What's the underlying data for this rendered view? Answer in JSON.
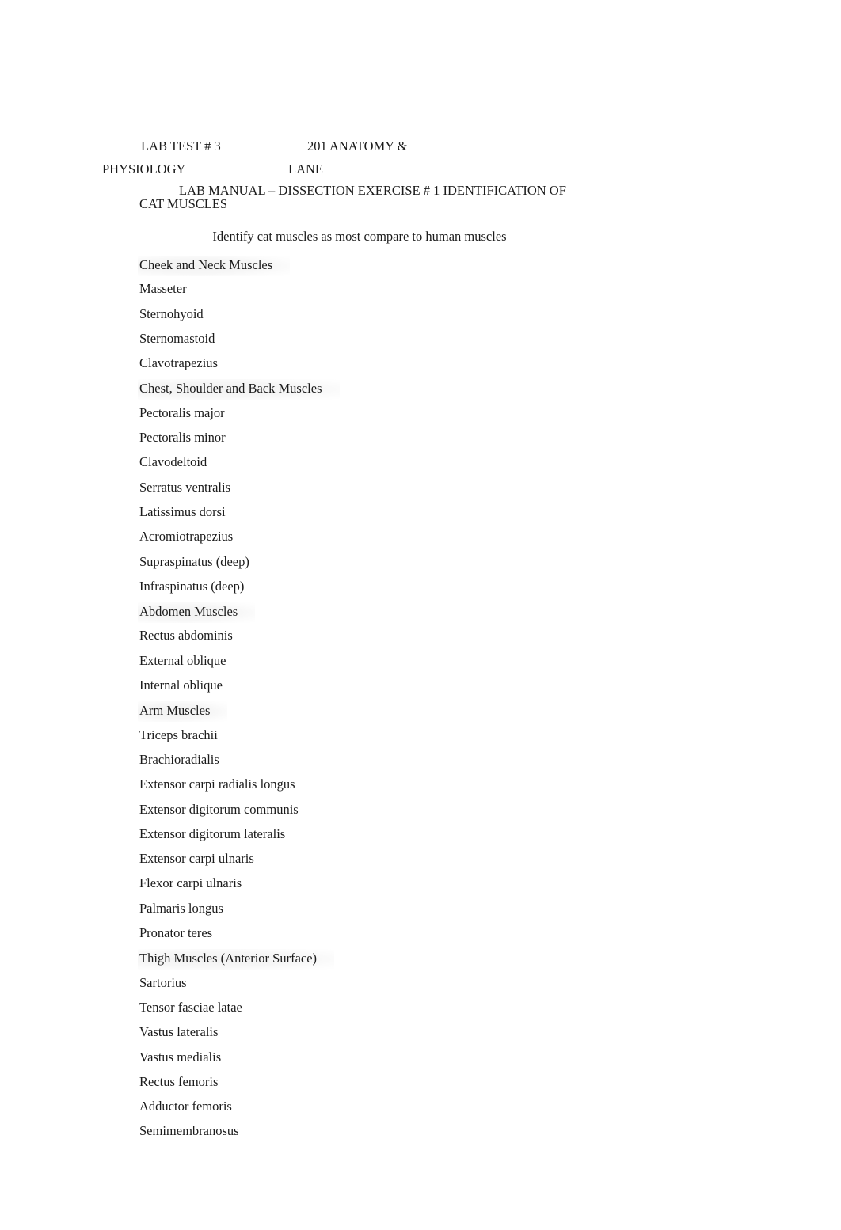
{
  "header": {
    "line1_left": "LAB TEST # 3",
    "line1_right": "201 ANATOMY &",
    "line2_left": "PHYSIOLOGY",
    "line2_right": "LANE"
  },
  "title": "LAB MANUAL – DISSECTION EXERCISE # 1 IDENTIFICATION OF CAT MUSCLES",
  "subtitle": "Identify cat muscles as most compare to human muscles",
  "list": [
    {
      "text": "Cheek and Neck Muscles",
      "type": "section"
    },
    {
      "text": "Masseter",
      "type": "item"
    },
    {
      "text": "Sternohyoid",
      "type": "item"
    },
    {
      "text": "Sternomastoid",
      "type": "item"
    },
    {
      "text": "Clavotrapezius",
      "type": "item"
    },
    {
      "text": "Chest, Shoulder and Back Muscles",
      "type": "section"
    },
    {
      "text": "Pectoralis major",
      "type": "item"
    },
    {
      "text": "Pectoralis minor",
      "type": "item"
    },
    {
      "text": "Clavodeltoid",
      "type": "item"
    },
    {
      "text": "Serratus ventralis",
      "type": "item"
    },
    {
      "text": "Latissimus dorsi",
      "type": "item"
    },
    {
      "text": "Acromiotrapezius",
      "type": "item"
    },
    {
      "text": "Supraspinatus (deep)",
      "type": "item"
    },
    {
      "text": "Infraspinatus (deep)",
      "type": "item"
    },
    {
      "text": "Abdomen Muscles",
      "type": "section"
    },
    {
      "text": "Rectus abdominis",
      "type": "item"
    },
    {
      "text": "External oblique",
      "type": "item"
    },
    {
      "text": "Internal oblique",
      "type": "item"
    },
    {
      "text": "Arm Muscles",
      "type": "section"
    },
    {
      "text": "Triceps brachii",
      "type": "item"
    },
    {
      "text": "Brachioradialis",
      "type": "item"
    },
    {
      "text": "Extensor carpi radialis longus",
      "type": "item"
    },
    {
      "text": "Extensor digitorum communis",
      "type": "item"
    },
    {
      "text": "Extensor digitorum lateralis",
      "type": "item"
    },
    {
      "text": "Extensor carpi ulnaris",
      "type": "item"
    },
    {
      "text": "Flexor carpi ulnaris",
      "type": "item"
    },
    {
      "text": "Palmaris longus",
      "type": "item"
    },
    {
      "text": "Pronator teres",
      "type": "item"
    },
    {
      "text": "Thigh Muscles (Anterior Surface)",
      "type": "section"
    },
    {
      "text": "Sartorius",
      "type": "item"
    },
    {
      "text": "Tensor fasciae latae",
      "type": "item"
    },
    {
      "text": "Vastus lateralis",
      "type": "item"
    },
    {
      "text": "Vastus medialis",
      "type": "item"
    },
    {
      "text": "Rectus femoris",
      "type": "item"
    },
    {
      "text": "Adductor femoris",
      "type": "item"
    },
    {
      "text": "Semimembranosus",
      "type": "item"
    }
  ]
}
